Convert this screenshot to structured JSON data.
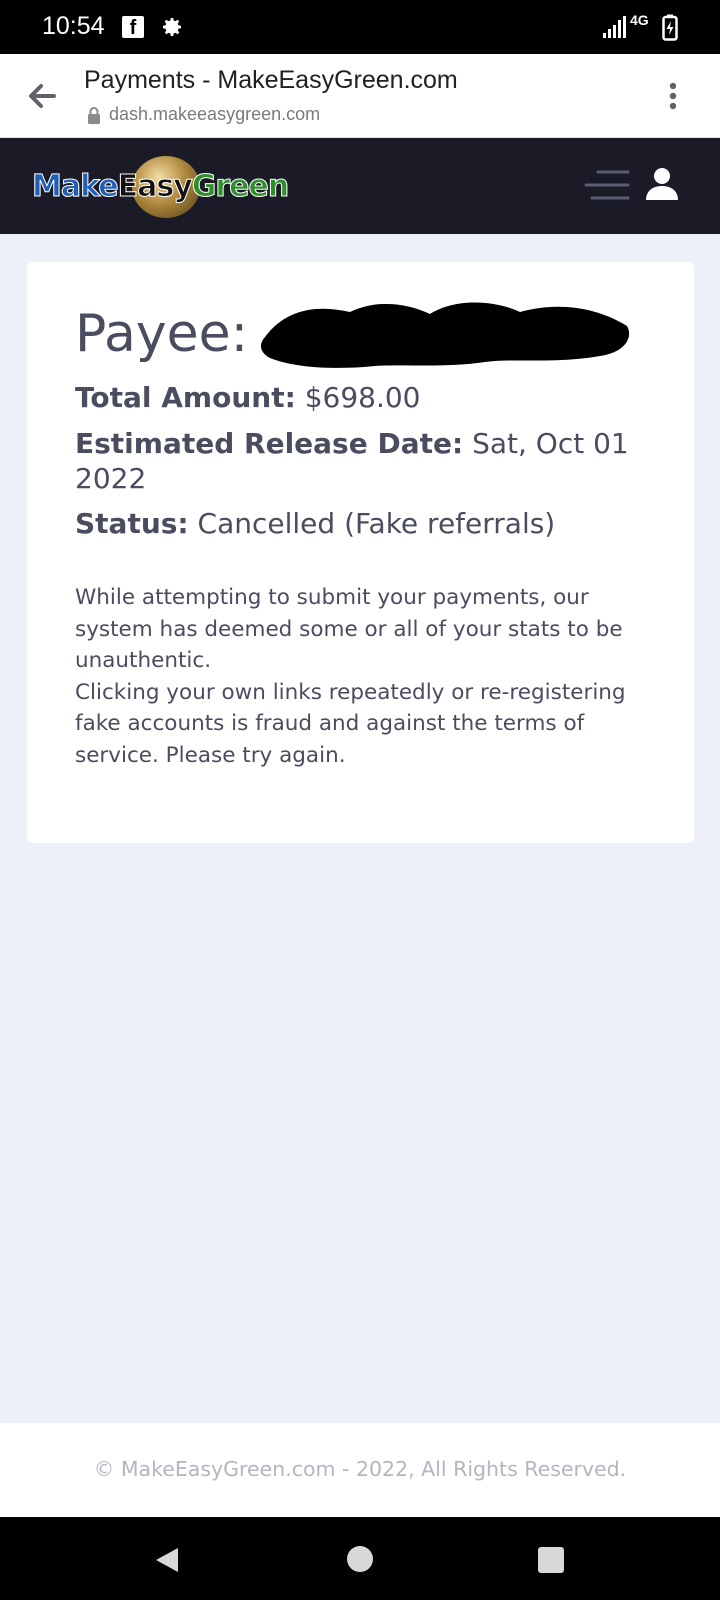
{
  "status_bar": {
    "time": "10:54",
    "network": "4G",
    "icons": [
      "facebook-icon",
      "gear-icon",
      "signal-icon",
      "battery-charging-icon"
    ]
  },
  "browser": {
    "title": "Payments - MakeEasyGreen.com",
    "url": "dash.makeeasygreen.com",
    "icons": [
      "back-arrow-icon",
      "lock-icon",
      "more-vert-icon"
    ]
  },
  "site_header": {
    "logo": {
      "make": "Make",
      "easy": "Easy",
      "green": "Green"
    },
    "icons": [
      "hamburger-icon",
      "user-icon"
    ],
    "colors": {
      "background": "#1b1b28",
      "logo_blue": "#1f5fb8",
      "logo_green": "#2e8f2a"
    }
  },
  "payment": {
    "payee_label": "Payee:",
    "amount_label": "Total Amount:",
    "amount_value": "$698.00",
    "release_label": "Estimated Release Date:",
    "release_value": "Sat, Oct 01 2022",
    "status_label": "Status:",
    "status_value": "Cancelled (Fake referrals)",
    "message_line1": "While attempting to submit your payments, our system has deemed some or all of your stats to be unauthentic.",
    "message_line2": "Clicking your own links repeatedly or re-registering fake accounts is fraud and against the terms of service. Please try again."
  },
  "footer": {
    "text": "© MakeEasyGreen.com - 2022, All Rights Reserved."
  },
  "nav_bar": {
    "icons": [
      "nav-back-icon",
      "nav-home-icon",
      "nav-recent-icon"
    ]
  },
  "colors": {
    "page_background": "#eef0f9",
    "text": "#4a4c5f"
  }
}
